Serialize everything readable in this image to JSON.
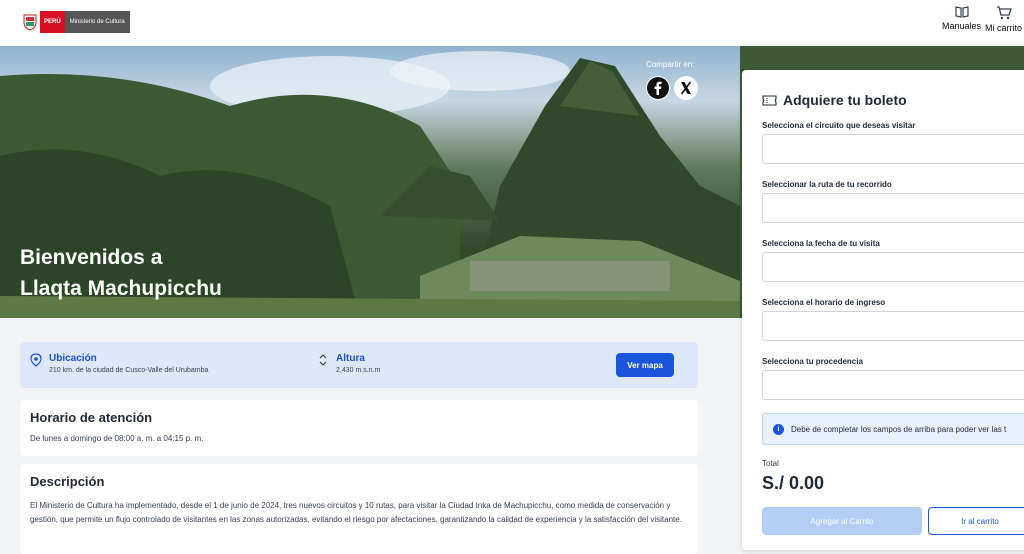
{
  "header": {
    "logo_peru": "PERÚ",
    "logo_ministry": "Ministerio de Cultura",
    "manuals_label": "Manuales",
    "cart_label": "Mi carrito"
  },
  "hero": {
    "title_line1": "Bienvenidos a",
    "title_line2": "Llaqta Machupicchu",
    "share_label": "Compartir en:"
  },
  "info": {
    "location_label": "Ubicación",
    "location_value": "210 km. de la ciudad de Cusco-Valle del Urubamba",
    "altitude_label": "Altura",
    "altitude_value": "2,430 m.s.n.m",
    "map_button": "Ver mapa"
  },
  "schedule": {
    "title": "Horario de atención",
    "text": "De lunes a domingo de 08:00 a. m. a 04:15 p. m."
  },
  "description": {
    "title": "Descripción",
    "text": "El Ministerio de Cultura ha implementado, desde el 1 de junio de 2024, tres nuevos circuitos y 10 rutas, para visitar la Ciudad Inka de Machupicchu, como medida de conservación y gestión, que permite un flujo controlado de visitantes en las zonas autorizadas, evitando el riesgo por afectaciones, garantizando la calidad de experiencia y la satisfacción del visitante."
  },
  "ticket": {
    "title": "Adquiere tu boleto",
    "fields": [
      {
        "label": "Selecciona el circuito que deseas visitar",
        "value": ""
      },
      {
        "label": "Seleccionar la ruta de tu recorrido",
        "value": ""
      },
      {
        "label": "Selecciona la fecha de tu visita",
        "value": ""
      },
      {
        "label": "Selecciona el horario de ingreso",
        "value": ""
      },
      {
        "label": "Selecciona tu procedencia",
        "value": ""
      }
    ],
    "notice": "Debe de completar los campos de arriba para poder ver las t",
    "total_label": "Total",
    "total_value": "S./ 0.00",
    "add_button": "Agregar al Carrito",
    "go_cart_button": "Ir al carrito"
  },
  "colors": {
    "primary": "#1a56db",
    "info_bg": "#dde9fb",
    "brand_red": "#d91023"
  }
}
